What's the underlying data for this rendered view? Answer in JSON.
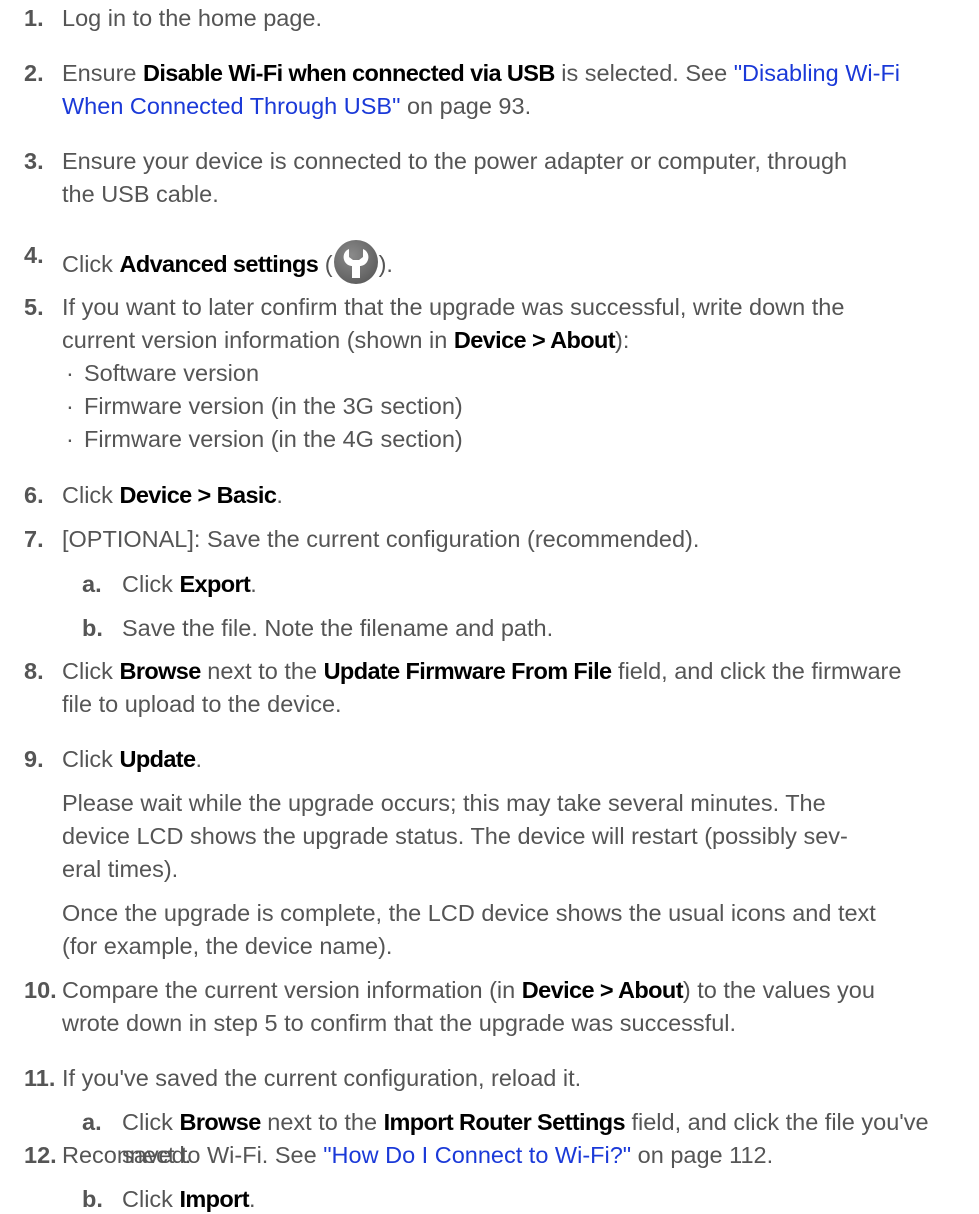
{
  "steps": {
    "s1": {
      "num": "1.",
      "t1": "Log in to the home page."
    },
    "s2": {
      "num": "2.",
      "t1": "Ensure ",
      "ui1": "Disable Wi-Fi when connected via USB",
      "t2": " is selected. See ",
      "link1": "\"Disabling Wi-Fi",
      "link2": "When Connected Through USB\"",
      "t3": " on page 93."
    },
    "s3": {
      "num": "3.",
      "t1": "Ensure your device is connected to the power adapter or computer, through",
      "t2": "the USB cable."
    },
    "s4": {
      "num": "4.",
      "t1": "Click ",
      "ui1": "Advanced settings",
      "t2": " (",
      "icon": "wrench-icon",
      "t3": ")."
    },
    "s5": {
      "num": "5.",
      "t1": "If you want to later confirm that the upgrade was successful, write down the",
      "t2": "current version information (shown in ",
      "ui1": "Device > About",
      "t3": "):",
      "bullets": [
        "Software version",
        "Firmware version (in the 3G section)",
        "Firmware version (in the 4G section)"
      ]
    },
    "s6": {
      "num": "6.",
      "t1": "Click ",
      "ui1": "Device > Basic",
      "t2": "."
    },
    "s7": {
      "num": "7.",
      "t1": "[OPTIONAL]: Save the current configuration (recommended).",
      "a_letter": "a.",
      "a_t1": "Click ",
      "a_ui1": "Export",
      "a_t2": ".",
      "b_letter": "b.",
      "b_t1": "Save the file. Note the filename and path."
    },
    "s8": {
      "num": "8.",
      "t1": "Click ",
      "ui1": "Browse",
      "t2": " next to the ",
      "ui2": "Update Firmware From File",
      "t3": " field, and click the firmware",
      "t4": "file to upload to the device."
    },
    "s9": {
      "num": "9.",
      "t1": "Click ",
      "ui1": "Update",
      "t2": ".",
      "p1_l1": "Please wait while the upgrade occurs; this may take several minutes. The",
      "p1_l2": "device LCD shows the upgrade status. The device will restart (possibly sev-",
      "p1_l3": "eral times).",
      "p2_l1": "Once the upgrade is complete, the LCD device shows the usual icons and text",
      "p2_l2": "(for example, the device name)."
    },
    "s10": {
      "num": "10.",
      "t1": "Compare the current version information (in ",
      "ui1": "Device > About",
      "t2": ") to the values you",
      "t3": "wrote down in step 5 to confirm that the upgrade was successful."
    },
    "s11": {
      "num": "11.",
      "t1": "If you've saved the current configuration, reload it.",
      "a_letter": "a.",
      "a_t1": "Click ",
      "a_ui1": "Browse",
      "a_t2": " next to the ",
      "a_ui2": "Import Router Settings",
      "a_t3": " field, and click the file you've",
      "a_t4": "saved.",
      "b_letter": "b.",
      "b_t1": "Click ",
      "b_ui1": "Import",
      "b_t2": "."
    },
    "s12": {
      "num": "12.",
      "t1": "Reconnect to Wi-Fi. See ",
      "link1": "\"How Do I Connect to Wi-Fi?\"",
      "t2": " on page 112."
    }
  },
  "colors": {
    "text": "#555555",
    "ui_term": "#000000",
    "link": "#1a39d8",
    "icon_bg": "#6b6b6b"
  }
}
